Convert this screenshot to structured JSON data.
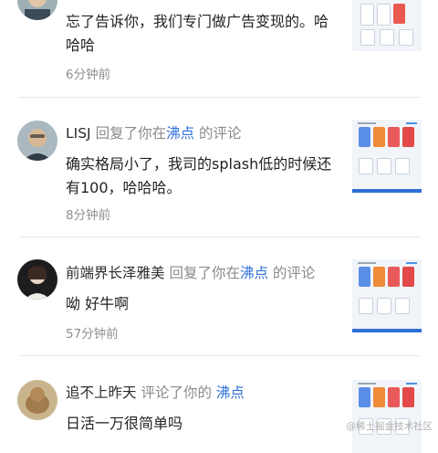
{
  "items": [
    {
      "user": "",
      "action": "",
      "link": "",
      "suffix": "",
      "content": "忘了告诉你，我们专门做广告变现的。哈哈哈",
      "time": "6分钟前"
    },
    {
      "user": "LISJ",
      "action": "回复了你在",
      "link": "沸点",
      "suffix": "的评论",
      "content": "确实格局小了，我司的splash低的时候还有100，哈哈哈。",
      "time": "8分钟前"
    },
    {
      "user": "前端界长泽雅美",
      "action": "回复了你在",
      "link": "沸点",
      "suffix": "的评论",
      "content": "呦 好牛啊",
      "time": "57分钟前"
    },
    {
      "user": "追不上昨天",
      "action": "评论了你的",
      "link": "沸点",
      "suffix": "",
      "content": "日活一万很简单吗",
      "time": ""
    }
  ],
  "watermark": "@稀土掘金技术社区"
}
